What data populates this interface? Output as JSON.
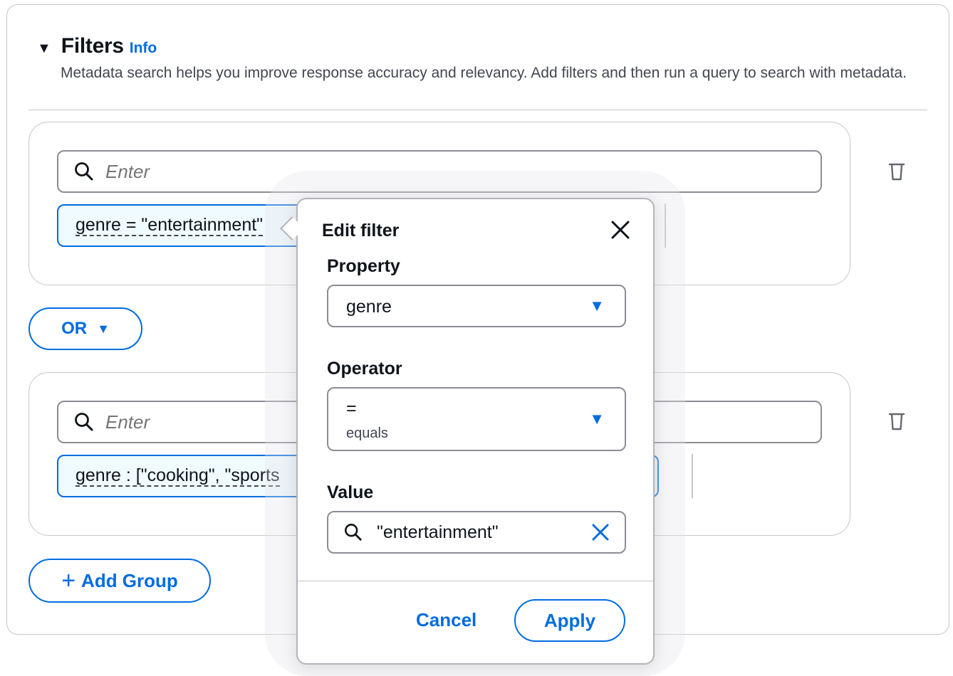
{
  "section": {
    "title": "Filters",
    "info_link": "Info",
    "description": "Metadata search helps you improve response accuracy and relevancy. Add filters and then run a query to search with metadata."
  },
  "groups": [
    {
      "search_placeholder": "Enter",
      "token": "genre = \"entertainment\""
    },
    {
      "search_placeholder": "Enter",
      "token": "genre : [\"cooking\", \"sports"
    }
  ],
  "group_operator": {
    "label": "OR"
  },
  "add_group": {
    "label": "Add Group"
  },
  "edit_filter": {
    "title": "Edit filter",
    "property": {
      "label": "Property",
      "value": "genre"
    },
    "operator": {
      "label": "Operator",
      "value": "=",
      "description": "equals"
    },
    "value": {
      "label": "Value",
      "value": "\"entertainment\""
    },
    "cancel_label": "Cancel",
    "apply_label": "Apply"
  },
  "icons": {
    "caret": "caret-down-icon",
    "search": "search-icon",
    "delete": "trash-icon",
    "close": "close-icon",
    "clear": "clear-icon",
    "dropdown": "triangle-down-icon",
    "plus": "plus-icon"
  },
  "colors": {
    "accent": "#006ce0",
    "token_bg": "#f0fbff",
    "border": "#8c8c94",
    "text": "#0f141a"
  }
}
